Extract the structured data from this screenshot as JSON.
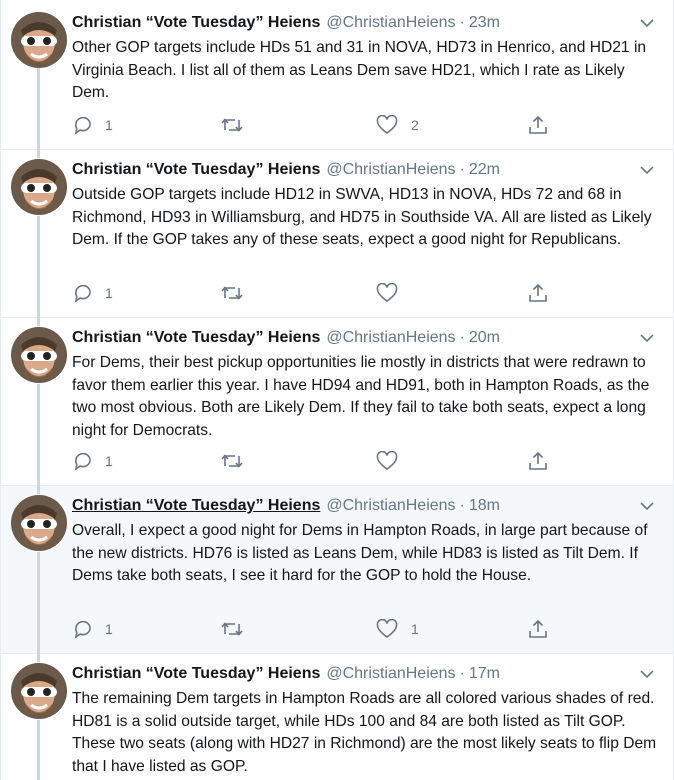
{
  "tweets": [
    {
      "author_name": "Christian “Vote Tuesday” Heiens",
      "handle": "@ChristianHeiens",
      "separator": "·",
      "time": "23m",
      "text": "Other GOP targets include HDs 51 and 31 in NOVA, HD73 in Henrico, and HD21 in Virginia Beach. I list all of them as Leans Dem save HD21, which I rate as Likely Dem.",
      "replies": "1",
      "retweets": "",
      "likes": "2"
    },
    {
      "author_name": "Christian “Vote Tuesday” Heiens",
      "handle": "@ChristianHeiens",
      "separator": "·",
      "time": "22m",
      "text": "Outside GOP targets include HD12 in SWVA, HD13 in NOVA, HDs 72 and 68 in Richmond, HD93 in Williamsburg, and HD75 in Southside VA. All are listed as Likely Dem. If the GOP takes any of these seats, expect a good night for Republicans.",
      "replies": "1",
      "retweets": "",
      "likes": ""
    },
    {
      "author_name": "Christian “Vote Tuesday” Heiens",
      "handle": "@ChristianHeiens",
      "separator": "·",
      "time": "20m",
      "text": "For Dems, their best pickup opportunities lie mostly in districts that were redrawn to favor them earlier this year. I have HD94 and HD91, both in Hampton Roads, as the two most obvious. Both are Likely Dem. If they fail to take both seats, expect a long night for Democrats.",
      "replies": "1",
      "retweets": "",
      "likes": ""
    },
    {
      "author_name": "Christian “Vote Tuesday” Heiens",
      "handle": "@ChristianHeiens",
      "separator": "·",
      "time": "18m",
      "text": "Overall, I expect a good night for Dems in Hampton Roads, in large part because of the new districts. HD76 is listed as Leans Dem, while HD83 is listed as Tilt Dem. If Dems take both seats, I see it hard for the GOP to hold the House.",
      "replies": "1",
      "retweets": "",
      "likes": "1"
    },
    {
      "author_name": "Christian “Vote Tuesday” Heiens",
      "handle": "@ChristianHeiens",
      "separator": "·",
      "time": "17m",
      "text": "The remaining Dem targets in Hampton Roads are all colored various shades of red. HD81 is a solid outside target, while HDs 100 and 84 are both listed as Tilt GOP. These two seats (along with HD27 in Richmond) are the most likely seats to flip Dem that I have listed as GOP.",
      "replies": "",
      "retweets": "",
      "likes": ""
    }
  ],
  "icons": {
    "reply": "reply-icon",
    "retweet": "retweet-icon",
    "like": "heart-icon",
    "share": "share-icon",
    "caret": "chevron-down-icon"
  },
  "colors": {
    "text": "#14171a",
    "secondary": "#657786",
    "thread_line": "#ccd6dd",
    "border": "#e6ecf0",
    "hover_bg": "#f5f8fa"
  }
}
